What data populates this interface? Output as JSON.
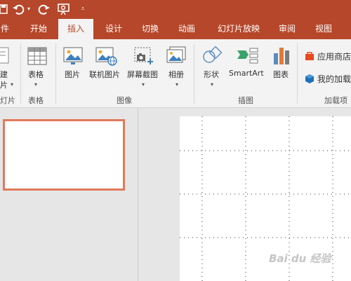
{
  "quick_access": {
    "save_icon": "save-icon",
    "undo_icon": "undo-icon",
    "redo_icon": "redo-icon",
    "present_icon": "present-from-start-icon",
    "customize_icon": "customize-qat-icon"
  },
  "tabs": [
    {
      "label": "件"
    },
    {
      "label": "开始"
    },
    {
      "label": "插入"
    },
    {
      "label": "设计"
    },
    {
      "label": "切换"
    },
    {
      "label": "动画"
    },
    {
      "label": "幻灯片放映"
    },
    {
      "label": "审阅"
    },
    {
      "label": "视图"
    }
  ],
  "ribbon": {
    "new_slide": {
      "line1": "建",
      "line2": "片"
    },
    "table": {
      "label": "表格",
      "group": "表格"
    },
    "images_group": "图像",
    "picture": {
      "label": "图片"
    },
    "online_picture": {
      "label": "联机图片"
    },
    "screenshot": {
      "label": "屏幕截图"
    },
    "album": {
      "label": "相册"
    },
    "illustrations_group": "插图",
    "shapes": {
      "label": "形状"
    },
    "smartart": {
      "label": "SmartArt"
    },
    "chart": {
      "label": "图表"
    },
    "addins_group": "加载项",
    "store": {
      "label": "应用商店"
    },
    "my_addins": {
      "label": "我的加载"
    },
    "slides_group_partial": "灯片"
  },
  "watermark": "Bai du 经验",
  "colors": {
    "accent": "#b7472a",
    "thumb_border": "#e07a5a"
  }
}
